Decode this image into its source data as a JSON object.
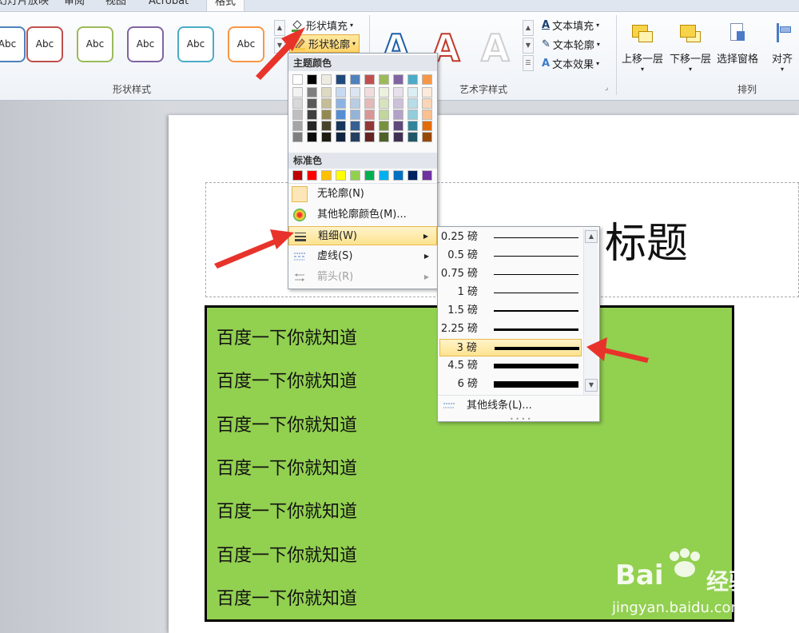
{
  "tabs": [
    {
      "label": "幻灯片放映"
    },
    {
      "label": "审阅"
    },
    {
      "label": "视图"
    },
    {
      "label": "Acrobat"
    },
    {
      "label": "格式"
    }
  ],
  "ribbon": {
    "shape_styles": {
      "swatch_text": "Abc",
      "group_label": "形状样式",
      "swatch_colors": [
        "#4f81bd",
        "#c0504d",
        "#9bbb59",
        "#8064a2",
        "#4bacc6",
        "#f79646"
      ]
    },
    "shape_fill_label": "形状填充",
    "shape_outline_label": "形状轮廓",
    "wordart": {
      "group_label": "艺术字样式",
      "text_fill_label": "文本填充",
      "text_outline_label": "文本轮廓",
      "text_effects_label": "文本效果"
    },
    "arrange": {
      "group_label": "排列",
      "bring_forward_label": "上移一层",
      "send_backward_label": "下移一层",
      "selection_pane_label": "选择窗格",
      "align_label": "对齐"
    }
  },
  "outline_menu": {
    "theme_colors_label": "主题颜色",
    "standard_colors_label": "标准色",
    "theme_colors": [
      [
        "#ffffff",
        "#000000",
        "#eeece1",
        "#1f497d",
        "#4f81bd",
        "#c0504d",
        "#9bbb59",
        "#8064a2",
        "#4bacc6",
        "#f79646"
      ],
      [
        "#f2f2f2",
        "#7f7f7f",
        "#ddd9c3",
        "#c6d9f0",
        "#dbe5f1",
        "#f2dcdb",
        "#ebf1dd",
        "#e5e0ec",
        "#dbeef3",
        "#fdeada"
      ],
      [
        "#d8d8d8",
        "#595959",
        "#c4bd97",
        "#8db3e2",
        "#b8cce4",
        "#e5b9b7",
        "#d7e3bc",
        "#ccc1d9",
        "#b7dde8",
        "#fbd5b5"
      ],
      [
        "#bfbfbf",
        "#3f3f3f",
        "#938953",
        "#548dd4",
        "#95b3d7",
        "#d99694",
        "#c3d69b",
        "#b2a2c7",
        "#92cddc",
        "#fac08f"
      ],
      [
        "#a5a5a5",
        "#262626",
        "#494429",
        "#17365d",
        "#366092",
        "#953734",
        "#76923c",
        "#5f497a",
        "#31859b",
        "#e36c09"
      ],
      [
        "#7f7f7f",
        "#0c0c0c",
        "#1d1b10",
        "#0f243e",
        "#244061",
        "#632423",
        "#4f6128",
        "#3f3151",
        "#205867",
        "#974806"
      ]
    ],
    "standard_colors": [
      "#c00000",
      "#ff0000",
      "#ffc000",
      "#ffff00",
      "#92d050",
      "#00b050",
      "#00b0f0",
      "#0070c0",
      "#002060",
      "#7030a0"
    ],
    "no_outline_label": "无轮廓(N)",
    "more_colors_label": "其他轮廓颜色(M)...",
    "weight_label": "粗细(W)",
    "dashes_label": "虚线(S)",
    "arrows_label": "箭头(R)"
  },
  "weight_submenu": {
    "weights": [
      {
        "label": "0.25 磅",
        "pt": 0.25
      },
      {
        "label": "0.5 磅",
        "pt": 0.5
      },
      {
        "label": "0.75 磅",
        "pt": 0.75
      },
      {
        "label": "1 磅",
        "pt": 1
      },
      {
        "label": "1.5 磅",
        "pt": 1.5
      },
      {
        "label": "2.25 磅",
        "pt": 2.25
      },
      {
        "label": "3 磅",
        "pt": 3
      },
      {
        "label": "4.5 磅",
        "pt": 4.5
      },
      {
        "label": "6 磅",
        "pt": 6
      }
    ],
    "selected_label": "3 磅",
    "more_lines_label": "其他线条(L)..."
  },
  "slide": {
    "title_text": "标题",
    "body_lines": [
      "百度一下你就知道",
      "百度一下你就知道",
      "百度一下你就知道",
      "百度一下你就知道",
      "百度一下你就知道",
      "百度一下你就知道",
      "百度一下你就知道"
    ],
    "box_color": "#92d050"
  },
  "watermark": {
    "brand": "Bai",
    "brand2": "经验",
    "url": "jingyan.baidu.com"
  }
}
